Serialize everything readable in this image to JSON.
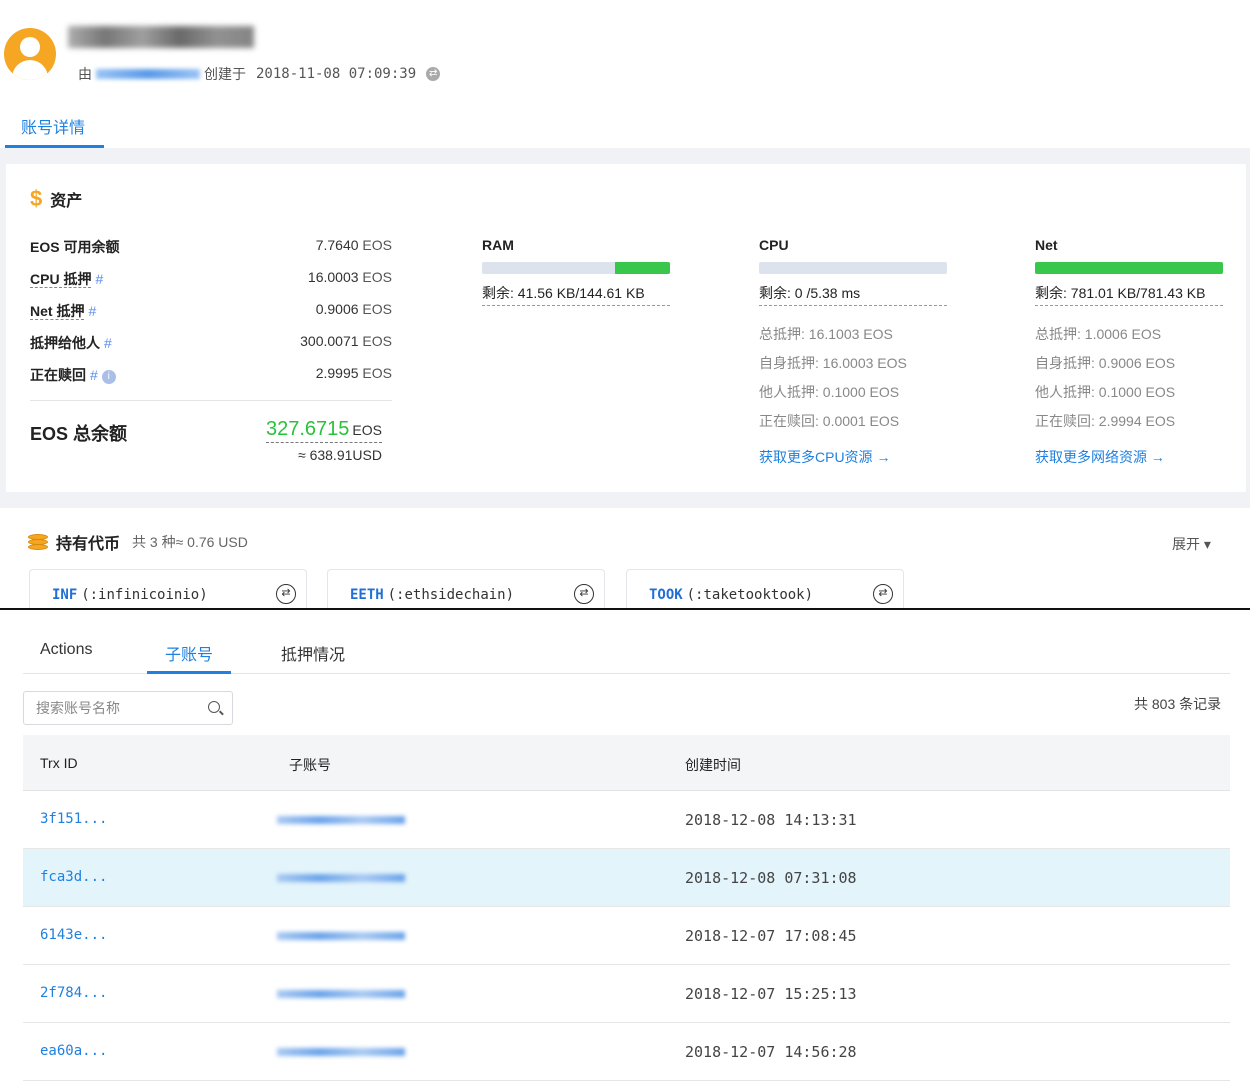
{
  "header": {
    "created_by_prefix": "由",
    "created_at_label": "创建于",
    "created_at": "2018-11-08 07:09:39",
    "tab": "账号详情"
  },
  "assets": {
    "title": "资产",
    "rows": [
      {
        "label": "EOS 可用余额",
        "hash": "",
        "value": "7.7640",
        "unit": "EOS"
      },
      {
        "label": "CPU 抵押",
        "hash": "#",
        "value": "16.0003",
        "unit": "EOS"
      },
      {
        "label": "Net 抵押",
        "hash": "#",
        "value": "0.9006",
        "unit": "EOS"
      },
      {
        "label": "抵押给他人",
        "hash": "#",
        "value": "300.0071",
        "unit": "EOS"
      },
      {
        "label": "正在赎回",
        "hash": "#",
        "value": "2.9995",
        "unit": "EOS"
      }
    ],
    "total_label": "EOS 总余额",
    "total_value": "327.6715",
    "total_unit": "EOS",
    "usd_value": "≈ 638.91USD"
  },
  "resources": {
    "ram": {
      "title": "RAM",
      "used_fraction": 0.71,
      "remain": "剩余: 41.56 KB/144.61 KB"
    },
    "cpu": {
      "title": "CPU",
      "used_fraction": 1.0,
      "remain": "剩余: 0 /5.38 ms",
      "stats": [
        "总抵押: 16.1003 EOS",
        "自身抵押: 16.0003 EOS",
        "他人抵押: 0.1000 EOS",
        "正在赎回: 0.0001 EOS"
      ],
      "link": "获取更多CPU资源 →"
    },
    "net": {
      "title": "Net",
      "used_fraction": 0.0,
      "remain": "剩余: 781.01 KB/781.43 KB",
      "stats": [
        "总抵押: 1.0006 EOS",
        "自身抵押: 0.9006 EOS",
        "他人抵押: 0.1000 EOS",
        "正在赎回: 2.9994 EOS"
      ],
      "link": "获取更多网络资源 →"
    }
  },
  "tokens": {
    "title": "持有代币",
    "summary": "共 3 种≈ 0.76 USD",
    "expand": "展开 ▾",
    "items": [
      {
        "symbol": "INF",
        "contract": "(:infinicoinio)"
      },
      {
        "symbol": "EETH",
        "contract": "(:ethsidechain)"
      },
      {
        "symbol": "TOOK",
        "contract": "(:taketooktook)"
      }
    ]
  },
  "sub_tabs": [
    "Actions",
    "子账号",
    "抵押情况"
  ],
  "search": {
    "placeholder": "搜索账号名称"
  },
  "record_count": "共 803 条记录",
  "table": {
    "columns": [
      "Trx ID",
      "子账号",
      "创建时间"
    ],
    "rows": [
      {
        "trx_id": "3f151...",
        "created": "2018-12-08 14:13:31"
      },
      {
        "trx_id": "fca3d...",
        "created": "2018-12-08 07:31:08"
      },
      {
        "trx_id": "6143e...",
        "created": "2018-12-07 17:08:45"
      },
      {
        "trx_id": "2f784...",
        "created": "2018-12-07 15:25:13"
      },
      {
        "trx_id": "ea60a...",
        "created": "2018-12-07 14:56:28"
      }
    ]
  },
  "colors": {
    "accent": "#1f80e0",
    "green": "#38c74a",
    "orange": "#f5a623"
  }
}
